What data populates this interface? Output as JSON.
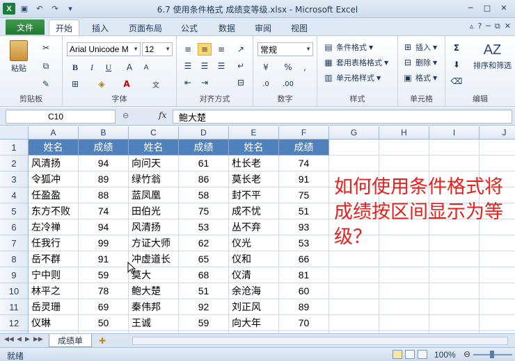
{
  "window": {
    "title": "6.7 使用条件格式 成绩变等级.xlsx - Microsoft Excel"
  },
  "tabs": {
    "file": "文件",
    "items": [
      "开始",
      "插入",
      "页面布局",
      "公式",
      "数据",
      "审阅",
      "视图"
    ]
  },
  "ribbon": {
    "clipboard": {
      "paste": "粘贴",
      "label": "剪贴板"
    },
    "font": {
      "name": "Arial Unicode M",
      "size": "12",
      "bold": "B",
      "italic": "I",
      "underline": "U",
      "label": "字体"
    },
    "alignment": {
      "label": "对齐方式"
    },
    "number": {
      "format": "常规",
      "label": "数字"
    },
    "styles": {
      "cond": "条件格式",
      "table": "套用表格格式",
      "cell": "单元格样式",
      "label": "样式"
    },
    "cells": {
      "insert": "插入",
      "delete": "删除",
      "format": "格式",
      "label": "单元格"
    },
    "editing": {
      "sort": "排序和筛选",
      "label": "编辑"
    }
  },
  "formula_bar": {
    "name_box": "C10",
    "fx": "fx",
    "content": "鲍大楚"
  },
  "grid": {
    "columns": [
      "A",
      "B",
      "C",
      "D",
      "E",
      "F",
      "G",
      "H",
      "I",
      "J"
    ],
    "rows": [
      "1",
      "2",
      "3",
      "4",
      "5",
      "6",
      "7",
      "8",
      "9",
      "10",
      "11",
      "12",
      "13"
    ],
    "table": [
      [
        "姓名",
        "成绩",
        "姓名",
        "成绩",
        "姓名",
        "成绩"
      ],
      [
        "风清扬",
        "94",
        "向问天",
        "61",
        "杜长老",
        "74"
      ],
      [
        "令狐冲",
        "89",
        "绿竹翁",
        "86",
        "莫长老",
        "91"
      ],
      [
        "任盈盈",
        "88",
        "蓝凤凰",
        "58",
        "封不平",
        "75"
      ],
      [
        "东方不败",
        "74",
        "田伯光",
        "75",
        "成不忧",
        "51"
      ],
      [
        "左冷禅",
        "94",
        "风清扬",
        "53",
        "丛不弃",
        "93"
      ],
      [
        "任我行",
        "99",
        "方证大师",
        "62",
        "仪光",
        "53"
      ],
      [
        "岳不群",
        "91",
        "冲虚道长",
        "65",
        "仪和",
        "66"
      ],
      [
        "宁中则",
        "59",
        "莫大",
        "68",
        "仪清",
        "81"
      ],
      [
        "林平之",
        "78",
        "鲍大楚",
        "51",
        "余沧海",
        "60"
      ],
      [
        "岳灵珊",
        "69",
        "秦伟邦",
        "92",
        "刘正风",
        "89"
      ],
      [
        "仪琳",
        "50",
        "王诚",
        "59",
        "向大年",
        "70"
      ],
      [
        "白问天",
        "",
        "王健",
        "",
        "米为义",
        ""
      ]
    ],
    "note": "如何使用条件格式将成绩按区间显示为等级？"
  },
  "sheets": {
    "tabs": [
      "成绩单"
    ]
  },
  "status": {
    "text": "就绪",
    "zoom": "100%"
  },
  "colors": {
    "header_fill": "#4f81bd",
    "note_text": "#e8201c",
    "file_tab": "#2a8a3a"
  }
}
